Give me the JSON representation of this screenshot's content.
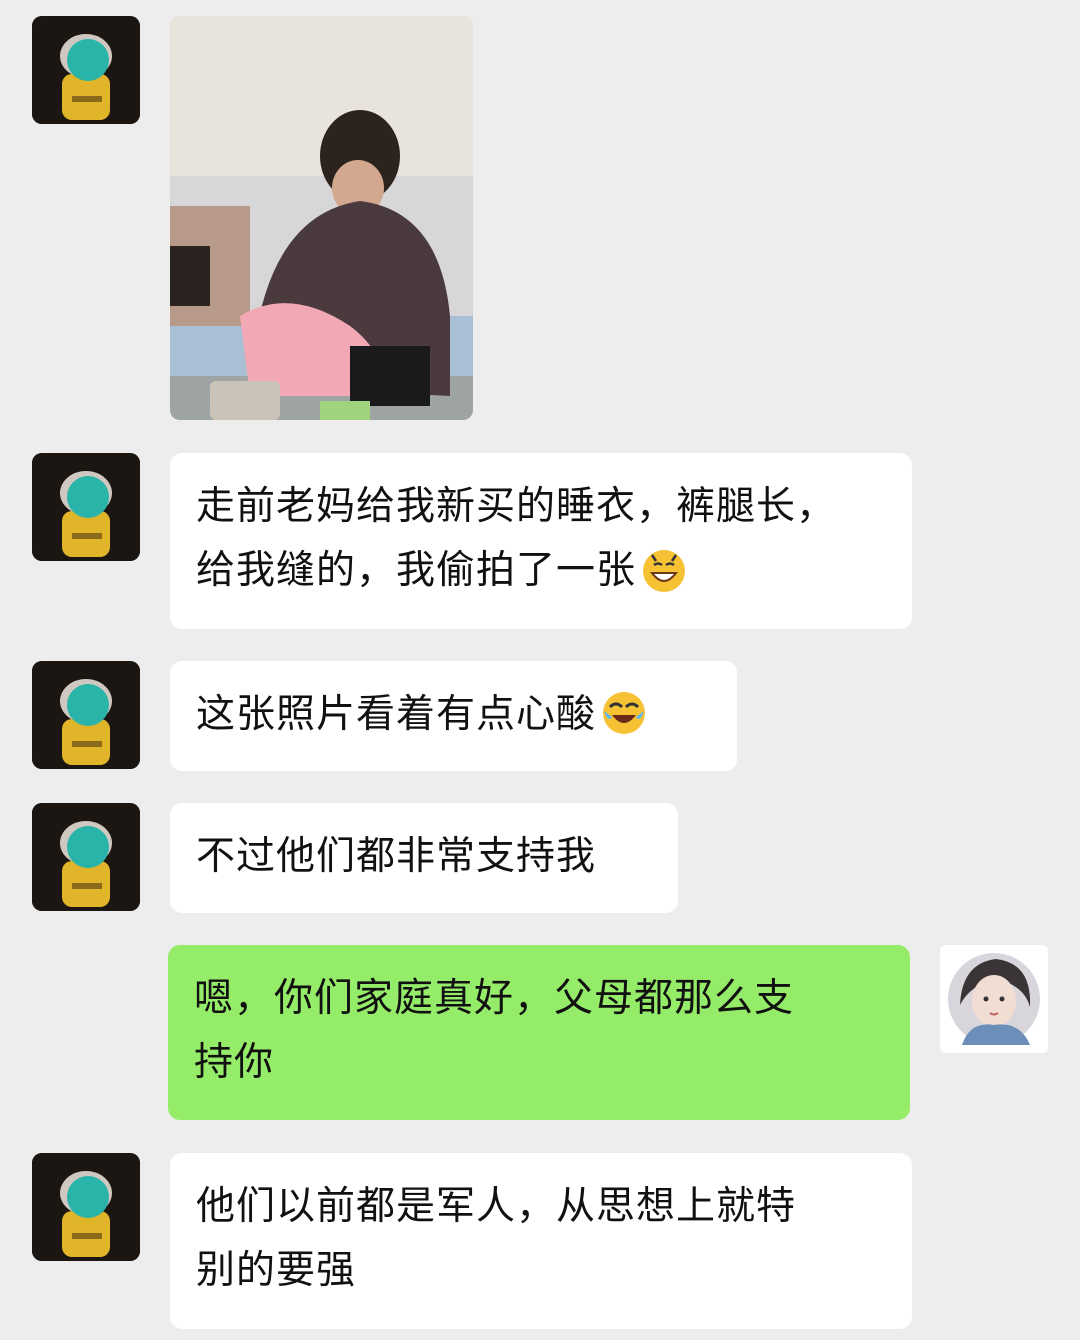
{
  "messages": [
    {
      "type": "image",
      "from": "contact",
      "image_description_icon": "photo-icon"
    },
    {
      "type": "text",
      "from": "contact",
      "lines": [
        "走前老妈给我新买的睡衣，裤腿长，",
        "给我缝的，我偷拍了一张"
      ],
      "emoji": "grin-emoji"
    },
    {
      "type": "text",
      "from": "contact",
      "lines": [
        "这张照片看着有点心酸"
      ],
      "emoji": "crying-laughing-emoji"
    },
    {
      "type": "text",
      "from": "contact",
      "lines": [
        "不过他们都非常支持我"
      ]
    },
    {
      "type": "text",
      "from": "me",
      "lines": [
        "嗯，你们家庭真好，父母都那么支",
        "持你"
      ]
    },
    {
      "type": "text",
      "from": "contact",
      "lines": [
        "他们以前都是军人，从思想上就特",
        "别的要强"
      ]
    }
  ],
  "colors": {
    "background": "#ededed",
    "incoming_bubble": "#ffffff",
    "outgoing_bubble": "#95ec69",
    "text": "#111111",
    "mask": "#2ab3a8"
  }
}
